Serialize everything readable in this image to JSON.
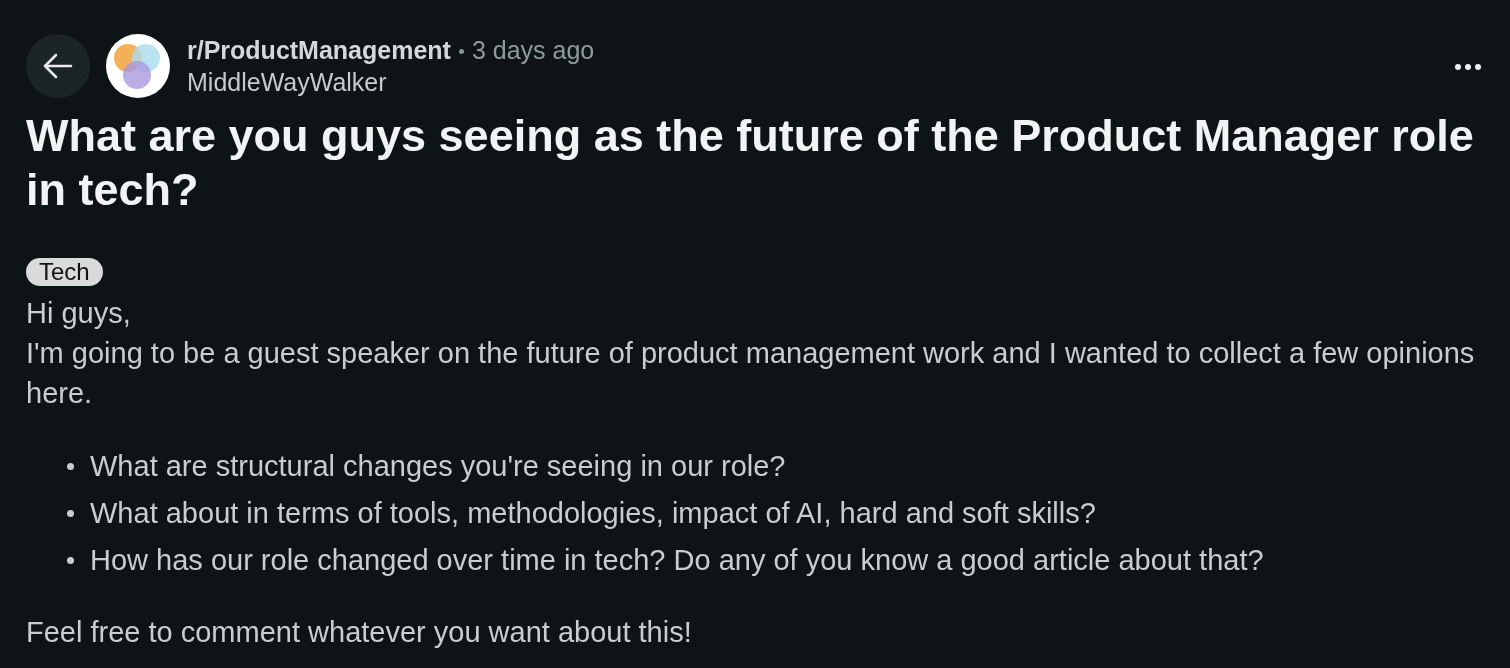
{
  "header": {
    "subreddit": "r/ProductManagement",
    "time": "3 days ago",
    "author": "MiddleWayWalker"
  },
  "title": "What are you guys seeing as the future of the Product Manager role in tech?",
  "flair": "Tech",
  "body": {
    "lines": [
      "Hi guys,",
      "I'm going to be a guest speaker on the future of product management work and I wanted to collect a few opinions here."
    ],
    "bullets": [
      "What are structural changes you're seeing in our role?",
      "What about in terms of tools, methodologies, impact of AI, hard and soft skills?",
      "How has our role changed over time in tech? Do any of you know a good article about that?"
    ],
    "closing": "Feel free to comment whatever you want about this!"
  }
}
